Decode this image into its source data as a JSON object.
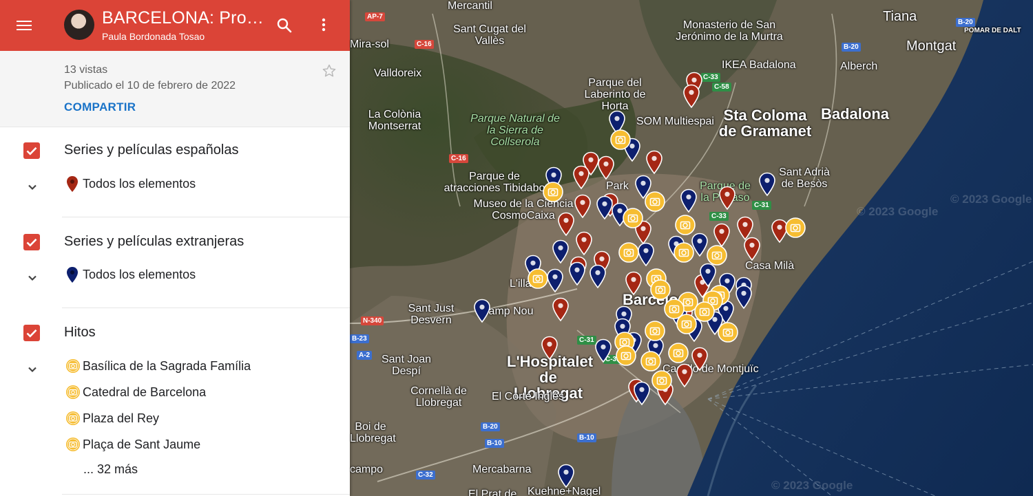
{
  "colors": {
    "brand": "#db4437",
    "checkbox": "#db4437",
    "pin_red": "#a52714",
    "pin_blue": "#0d1f6e",
    "pin_yellow": "#f6bd32"
  },
  "header": {
    "menu_icon": "hamburger-menu-icon",
    "title": "BARCELONA: Producciones audiovisuales",
    "author": "Paula Bordonada Tosao",
    "search_icon": "search-icon",
    "more_icon": "more-vert-icon"
  },
  "info": {
    "views": "13 vistas",
    "published": "Publicado el 10 de febrero de 2022",
    "share": "COMPARTIR",
    "star_icon": "star-icon"
  },
  "layers": [
    {
      "title": "Series y películas españolas",
      "items": [
        {
          "label": "Todos los elementos",
          "icon": "red-marker-icon"
        }
      ]
    },
    {
      "title": "Series y películas extranjeras",
      "items": [
        {
          "label": "Todos los elementos",
          "icon": "blue-marker-icon"
        }
      ]
    },
    {
      "title": "Hitos",
      "items": [
        {
          "label": "Basílica de la Sagrada Família",
          "icon": "camera-icon"
        },
        {
          "label": "Catedral de Barcelona",
          "icon": "camera-icon"
        },
        {
          "label": "Plaza del Rey",
          "icon": "camera-icon"
        },
        {
          "label": "Plaça de Sant Jaume",
          "icon": "camera-icon"
        }
      ],
      "more": "... 32 más"
    }
  ],
  "map": {
    "places": [
      "Mercantil",
      "Sant Cugat del Vallès",
      "Mira-sol",
      "Valldoreix",
      "La Colònia Montserrat",
      "Parque Natural de la Sierra de Collserola",
      "Parque del Laberinto de Horta",
      "Monasterio de San Jerónimo de la Murtra",
      "Tiana",
      "Montgat",
      "IKEA Badalona",
      "Alberch",
      "Sta Coloma de Gramanet",
      "Badalona",
      "SOM Multiespai",
      "Sant Adrià de Besòs",
      "Parque de la Pegaso",
      "Parque de atracciones Tibidabo",
      "Museo de la Ciencia CosmoCaixa",
      "Park",
      "L'illa",
      "Sant Just Desvern",
      "Camp Nou",
      "Casa Milà",
      "Barcelona",
      "L'Hospitalet de Llobregat",
      "Sant Joan Despí",
      "Cornellà de Llobregat",
      "El Corte Inglés",
      "Boi de Llobregat",
      "campo",
      "Mercabarna",
      "Kuehne+Nagel",
      "El Prat de",
      "Castillo de Montjuïc",
      "POMAR DE DALT",
      "Basílica de la Sagrada Família"
    ],
    "roads": [
      "AP-7",
      "C-16",
      "C-16",
      "C-33",
      "C-58",
      "B-20",
      "B-20",
      "C-31",
      "C-33",
      "N-340",
      "A-2",
      "B-23",
      "B-20",
      "B-10",
      "B-10",
      "C-32",
      "C-31",
      "C-31"
    ],
    "watermarks": [
      "© 2023 Google",
      "© 2023 Google",
      "© 2023 Google"
    ]
  }
}
